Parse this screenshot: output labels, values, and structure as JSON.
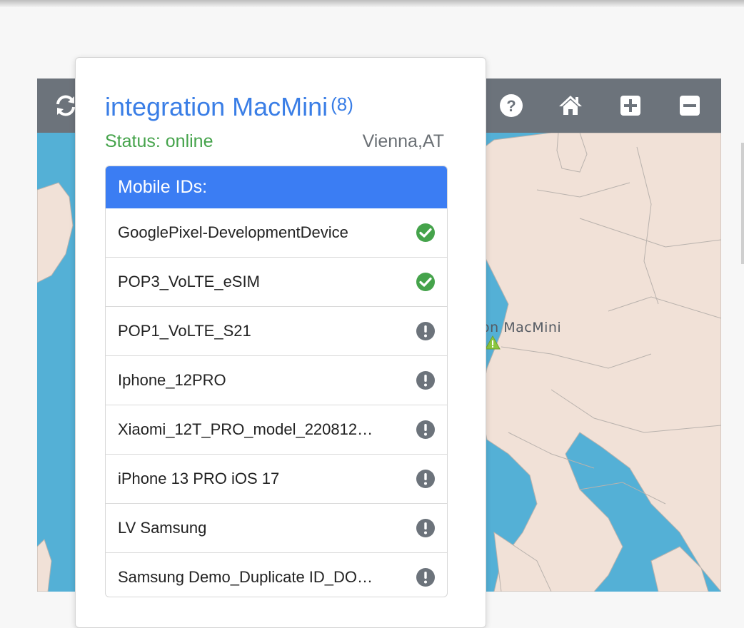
{
  "map": {
    "label": "on MacMini",
    "toolbar": {
      "refresh_icon": "refresh-icon",
      "help_icon": "question-circle-icon",
      "home_icon": "home-icon",
      "zoom_in_icon": "plus-square-icon",
      "zoom_out_icon": "minus-square-icon"
    },
    "colors": {
      "water": "#54b0d6",
      "land": "#f1e1d7",
      "toolbar": "#6c737b"
    }
  },
  "popup": {
    "title": "integration MacMini",
    "count": "(8)",
    "status": "Status: online",
    "location": "Vienna,AT",
    "list_header": "Mobile IDs:",
    "items": [
      {
        "label": "GooglePixel-DevelopmentDevice",
        "status": "ok"
      },
      {
        "label": "POP3_VoLTE_eSIM",
        "status": "ok"
      },
      {
        "label": "POP1_VoLTE_S21",
        "status": "warn"
      },
      {
        "label": "Iphone_12PRO",
        "status": "warn"
      },
      {
        "label": "Xiaomi_12T_PRO_model_220812…",
        "status": "warn"
      },
      {
        "label": "iPhone 13 PRO iOS 17",
        "status": "warn"
      },
      {
        "label": "LV Samsung",
        "status": "warn"
      },
      {
        "label": "Samsung Demo_Duplicate ID_DO…",
        "status": "warn"
      }
    ],
    "colors": {
      "title": "#3a7ee6",
      "status": "#45a34b",
      "header": "#3b7df3",
      "ok": "#45a34b",
      "warn": "#6c737b"
    }
  }
}
